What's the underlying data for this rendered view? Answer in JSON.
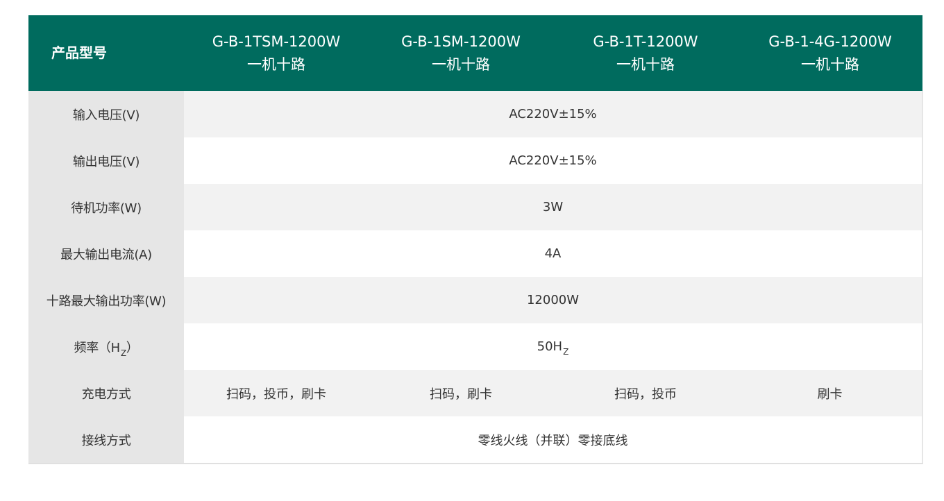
{
  "header": {
    "label": "产品型号",
    "models": [
      {
        "name": "G-B-1TSM-1200W",
        "sub": "一机十路"
      },
      {
        "name": "G-B-1SM-1200W",
        "sub": "一机十路"
      },
      {
        "name": "G-B-1T-1200W",
        "sub": "一机十路"
      },
      {
        "name": "G-B-1-4G-1200W",
        "sub": "一机十路"
      }
    ]
  },
  "rows": [
    {
      "label": "输入电压(V)",
      "value": "AC220V±15%"
    },
    {
      "label": "输出电压(V)",
      "value": "AC220V±15%"
    },
    {
      "label": "待机功率(W)",
      "value": "3W"
    },
    {
      "label": "最大输出电流(A)",
      "value": "4A"
    },
    {
      "label": "十路最大输出功率(W)",
      "value": "12000W"
    },
    {
      "label_prefix": "频率（H",
      "label_sub": "Z",
      "label_suffix": "）",
      "value_prefix": "50H",
      "value_sub": "Z"
    },
    {
      "label": "充电方式",
      "values": [
        "扫码，投币，刷卡",
        "扫码，刷卡",
        "扫码，投币",
        "刷卡"
      ]
    },
    {
      "label": "接线方式",
      "value": "零线火线（并联）零接底线"
    }
  ],
  "colors": {
    "header_bg": "#006b5e",
    "label_bg": "#e6e6e6",
    "stripe_bg": "#f2f2f2",
    "text": "#333333"
  }
}
